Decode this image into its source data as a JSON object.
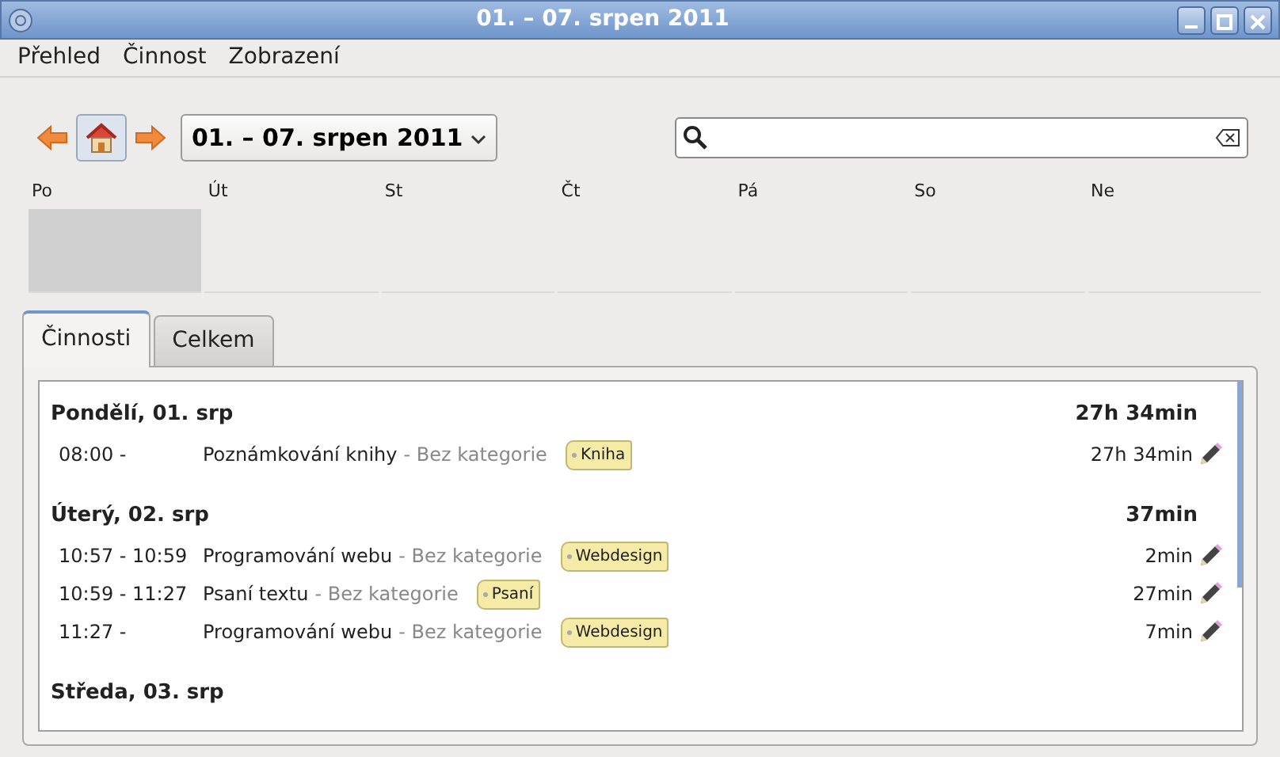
{
  "window": {
    "title": "01. – 07. srpen 2011"
  },
  "menu": [
    "Přehled",
    "Činnost",
    "Zobrazení"
  ],
  "toolbar": {
    "date_range": "01. – 07. srpen 2011"
  },
  "week": [
    {
      "label": "Po",
      "busy": true
    },
    {
      "label": "Út",
      "busy": false
    },
    {
      "label": "St",
      "busy": false
    },
    {
      "label": "Čt",
      "busy": false
    },
    {
      "label": "Pá",
      "busy": false
    },
    {
      "label": "So",
      "busy": false
    },
    {
      "label": "Ne",
      "busy": false
    }
  ],
  "tabs": [
    {
      "label": "Činnosti",
      "selected": true
    },
    {
      "label": "Celkem",
      "selected": false
    }
  ],
  "days": [
    {
      "title": "Pondělí, 01. srp",
      "total": "27h 34min",
      "activities": [
        {
          "time": "08:00 -",
          "name": "Poznámkování knihy",
          "category": "- Bez kategorie",
          "tag": "Kniha",
          "duration": "27h 34min"
        }
      ]
    },
    {
      "title": "Úterý, 02. srp",
      "total": "37min",
      "activities": [
        {
          "time": "10:57 - 10:59",
          "name": "Programování webu",
          "category": "- Bez kategorie",
          "tag": "Webdesign",
          "duration": "2min"
        },
        {
          "time": "10:59 - 11:27",
          "name": "Psaní textu",
          "category": "- Bez kategorie",
          "tag": "Psaní",
          "duration": "27min"
        },
        {
          "time": "11:27 -",
          "name": "Programování webu",
          "category": "- Bez kategorie",
          "tag": "Webdesign",
          "duration": "7min"
        }
      ]
    },
    {
      "title": "Středa, 03. srp"
    }
  ]
}
